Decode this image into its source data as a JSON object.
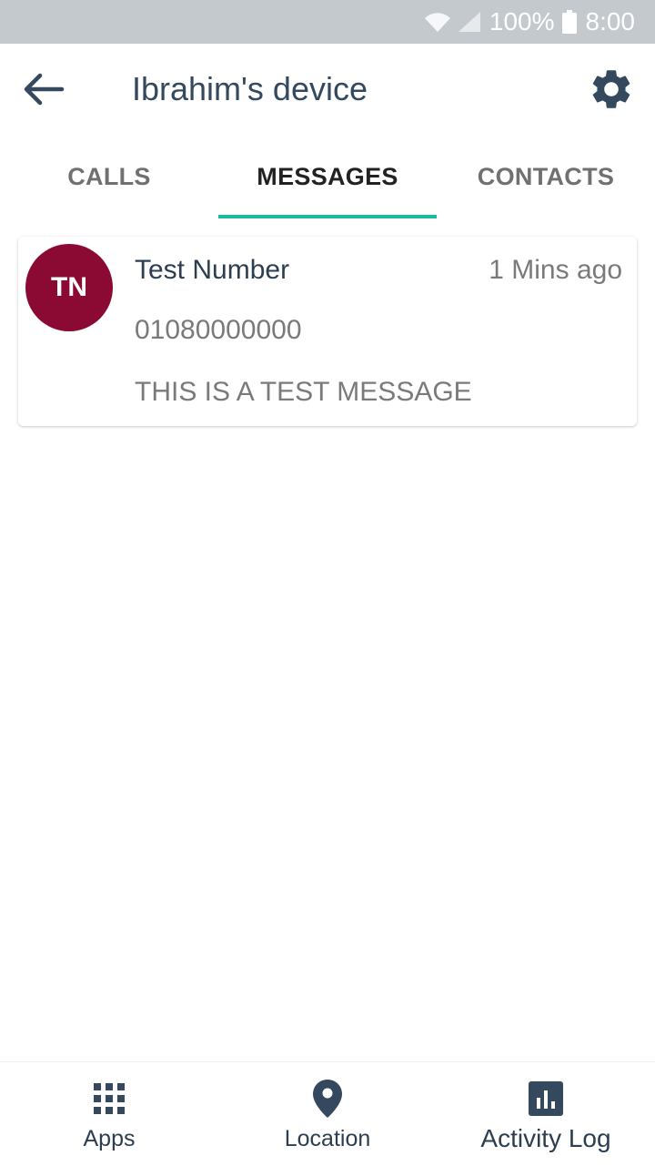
{
  "status_bar": {
    "battery_percent": "100%",
    "time": "8:00",
    "icons": [
      "wifi-icon",
      "signal-icon",
      "battery-icon"
    ]
  },
  "header": {
    "title": "Ibrahim's device",
    "back_icon": "arrow-left-icon",
    "settings_icon": "gear-icon"
  },
  "tabs": [
    {
      "label": "CALLS",
      "active": false
    },
    {
      "label": "MESSAGES",
      "active": true
    },
    {
      "label": "CONTACTS",
      "active": false
    }
  ],
  "messages": [
    {
      "initials": "TN",
      "name": "Test Number",
      "time": "1 Mins ago",
      "number": "01080000000",
      "body": "THIS IS A TEST MESSAGE",
      "avatar_color": "#8b0a33"
    }
  ],
  "bottom_nav": [
    {
      "label": "Apps",
      "icon": "grid-icon"
    },
    {
      "label": "Location",
      "icon": "location-pin-icon"
    },
    {
      "label": "Activity Log",
      "icon": "bar-chart-icon"
    }
  ],
  "colors": {
    "accent": "#1abc9c",
    "primary_text": "#34495e",
    "status_bar": "#c4c9cd"
  }
}
